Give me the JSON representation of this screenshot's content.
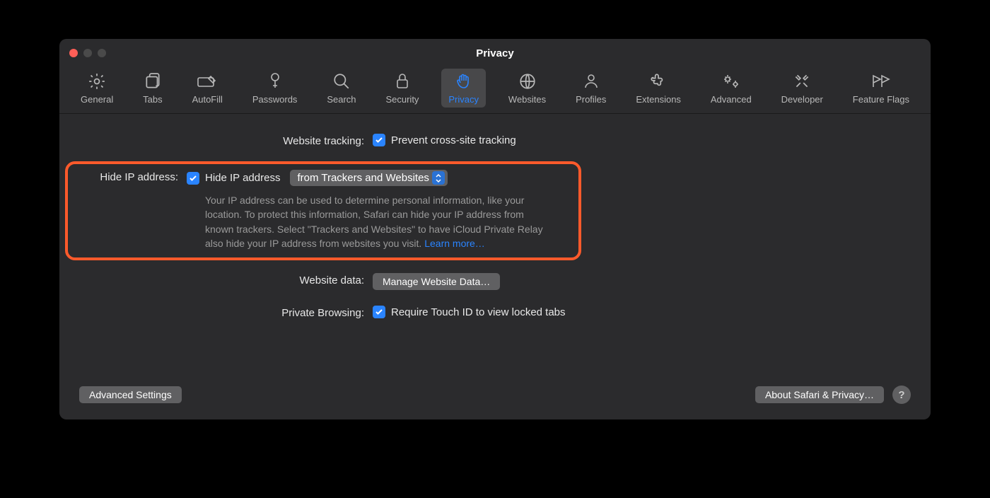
{
  "window": {
    "title": "Privacy"
  },
  "toolbar": {
    "items": [
      {
        "label": "General"
      },
      {
        "label": "Tabs"
      },
      {
        "label": "AutoFill"
      },
      {
        "label": "Passwords"
      },
      {
        "label": "Search"
      },
      {
        "label": "Security"
      },
      {
        "label": "Privacy"
      },
      {
        "label": "Websites"
      },
      {
        "label": "Profiles"
      },
      {
        "label": "Extensions"
      },
      {
        "label": "Advanced"
      },
      {
        "label": "Developer"
      },
      {
        "label": "Feature Flags"
      }
    ]
  },
  "rows": {
    "tracking_label": "Website tracking:",
    "tracking_checkbox": "Prevent cross-site tracking",
    "hideip_label": "Hide IP address:",
    "hideip_checkbox": "Hide IP address",
    "hideip_select": "from Trackers and Websites",
    "hideip_desc": "Your IP address can be used to determine personal information, like your location. To protect this information, Safari can hide your IP address from known trackers. Select \"Trackers and Websites\" to have iCloud Private Relay also hide your IP address from websites you visit. ",
    "hideip_learn": "Learn more…",
    "data_label": "Website data:",
    "data_button": "Manage Website Data…",
    "pb_label": "Private Browsing:",
    "pb_checkbox": "Require Touch ID to view locked tabs"
  },
  "footer": {
    "advanced": "Advanced Settings",
    "about": "About Safari & Privacy…",
    "help": "?"
  }
}
